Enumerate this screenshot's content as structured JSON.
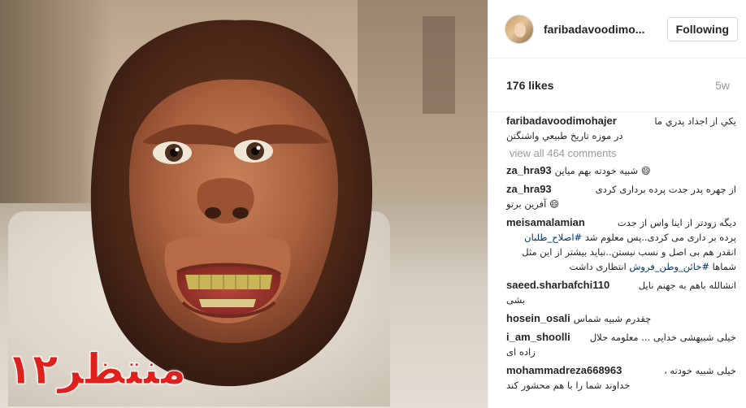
{
  "photo": {
    "alt": "",
    "watermark": "منتظر۱۲"
  },
  "header": {
    "username": "faribadavoodimo...",
    "follow_label": "Following",
    "avatar_icon": "avatar-icon"
  },
  "stats": {
    "likes": "176 likes",
    "time": "5w"
  },
  "caption": {
    "user": "faribadavoodimohajer",
    "line1": "يكي از اجداد پدري ما",
    "line2": "در موزه تاريخ طبيعي واشنگتن"
  },
  "view_all": "view all 464 comments",
  "comments": [
    {
      "user": "za_hra93",
      "text": "😄 شبیه خودته بهم میاین"
    },
    {
      "user": "za_hra93",
      "text": "از چهره پدر جدت پرده برداری کردی",
      "text2": "😄 آفرین برتو"
    },
    {
      "user": "meisamalamian",
      "text": "دیگه زودتر از اینا واس از جدت",
      "text2": "پرده بر داری می کردی..پس معلوم شد #اصلاح_طلبان",
      "text3": "انقدر هم بی اصل و نسب نیستن..نباید بیشتر از این مثل",
      "text4": "شماها #خائن_وطن_فروش انتظاری داشت"
    },
    {
      "user": "saeed.sharbafchi110",
      "text": "انشالله باهم به جهنم نایل",
      "text2": "بشی"
    },
    {
      "user": "hosein_osali",
      "text": "چقدرم شبیه شماس"
    },
    {
      "user": "i_am_shoolli",
      "text": "خیلی شبیهشی خدایی ... معلومه حلال",
      "text2": "زاده ای"
    },
    {
      "user": "mohammadreza668963",
      "text": "خیلی شبیه خودته ،",
      "text2": "خداوند شما را با هم محشور کند"
    }
  ],
  "colors": {
    "watermark": "#e0201c",
    "link": "#003569",
    "muted": "#999999",
    "text": "#262626"
  }
}
